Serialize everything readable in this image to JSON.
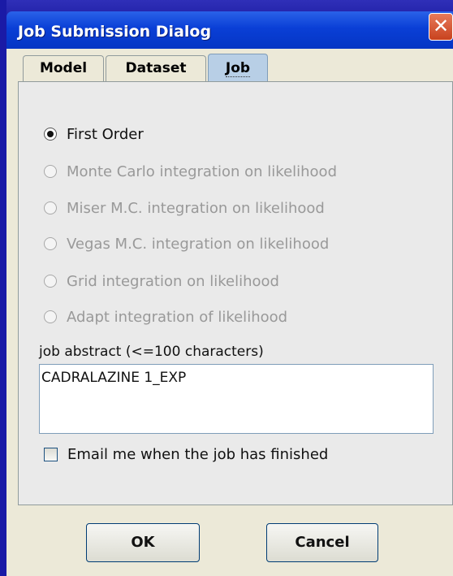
{
  "dialog": {
    "title": "Job Submission Dialog",
    "close_glyph": "✕"
  },
  "tabs": [
    {
      "label": "Model",
      "selected": false
    },
    {
      "label": "Dataset",
      "selected": false
    },
    {
      "label": "Job",
      "selected": true
    }
  ],
  "methods": [
    {
      "label": "First Order",
      "checked": true,
      "enabled": true
    },
    {
      "label": "Monte Carlo integration on likelihood",
      "checked": false,
      "enabled": false
    },
    {
      "label": "Miser M.C. integration on likelihood",
      "checked": false,
      "enabled": false
    },
    {
      "label": "Vegas M.C. integration on likelihood",
      "checked": false,
      "enabled": false
    },
    {
      "label": "Grid integration on likelihood",
      "checked": false,
      "enabled": false
    },
    {
      "label": "Adapt integration of likelihood",
      "checked": false,
      "enabled": false
    }
  ],
  "abstract": {
    "label": "job abstract (<=100 characters)",
    "value": "CADRALAZINE 1_EXP"
  },
  "email": {
    "label": "Email me when the job has finished",
    "checked": false
  },
  "buttons": {
    "ok": "OK",
    "cancel": "Cancel"
  },
  "colors": {
    "titlebar": "#0a3fd6",
    "close_button": "#c8421e",
    "window_bg": "#ece9d8",
    "selected_tab": "#b8cfe6",
    "disabled_text": "#999999"
  }
}
